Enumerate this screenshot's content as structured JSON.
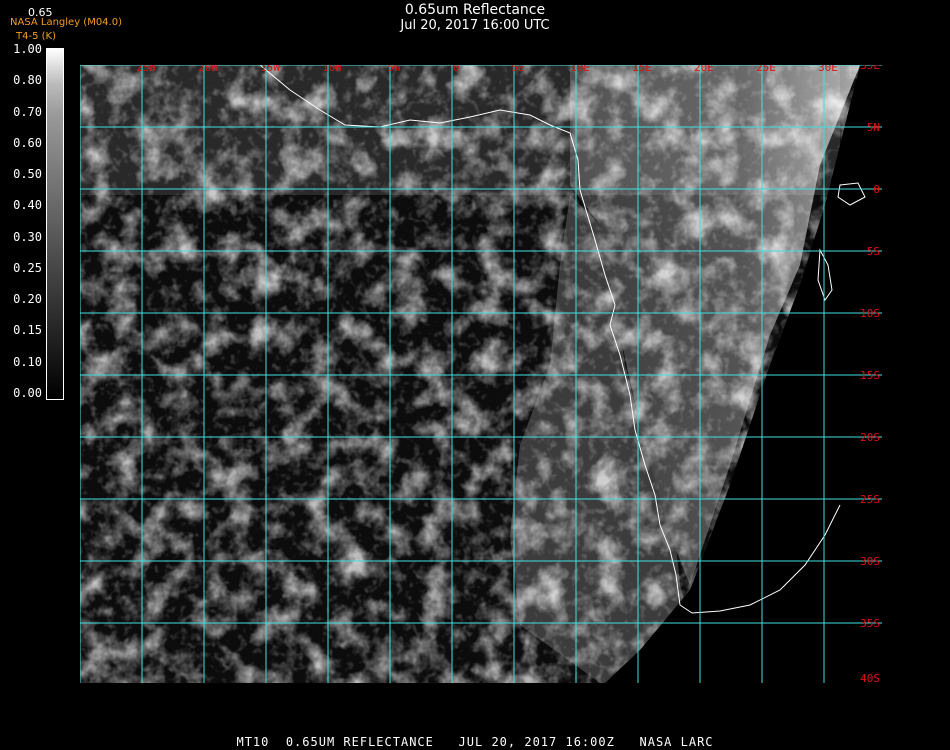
{
  "title": "0.65um Reflectance",
  "subtitle": "Jul 20, 2017 16:00 UTC",
  "credit_line1": "NASA Langley (M04.0)",
  "credit_line2": "T4-5 (K)",
  "colorbar": {
    "top_value": "0.65",
    "labels": [
      "1.00",
      "0.80",
      "0.70",
      "0.60",
      "0.50",
      "0.40",
      "0.30",
      "0.25",
      "0.20",
      "0.15",
      "0.10",
      "0.00"
    ]
  },
  "map": {
    "lon_labels": [
      "25W",
      "20W",
      "15W",
      "10W",
      "5W",
      "0",
      "5E",
      "10E",
      "15E",
      "20E",
      "25E",
      "30E"
    ],
    "lat_labels": [
      "35E",
      "5N",
      "0",
      "5S",
      "10S",
      "15S",
      "20S",
      "25S",
      "30S",
      "35S",
      "40S"
    ],
    "grid_color": "#40e0e0",
    "label_color": "#dd1111",
    "coast_color": "#ffffff"
  },
  "footer": "MT10  0.65UM REFLECTANCE   JUL 20, 2017 16:00Z   NASA LARC"
}
